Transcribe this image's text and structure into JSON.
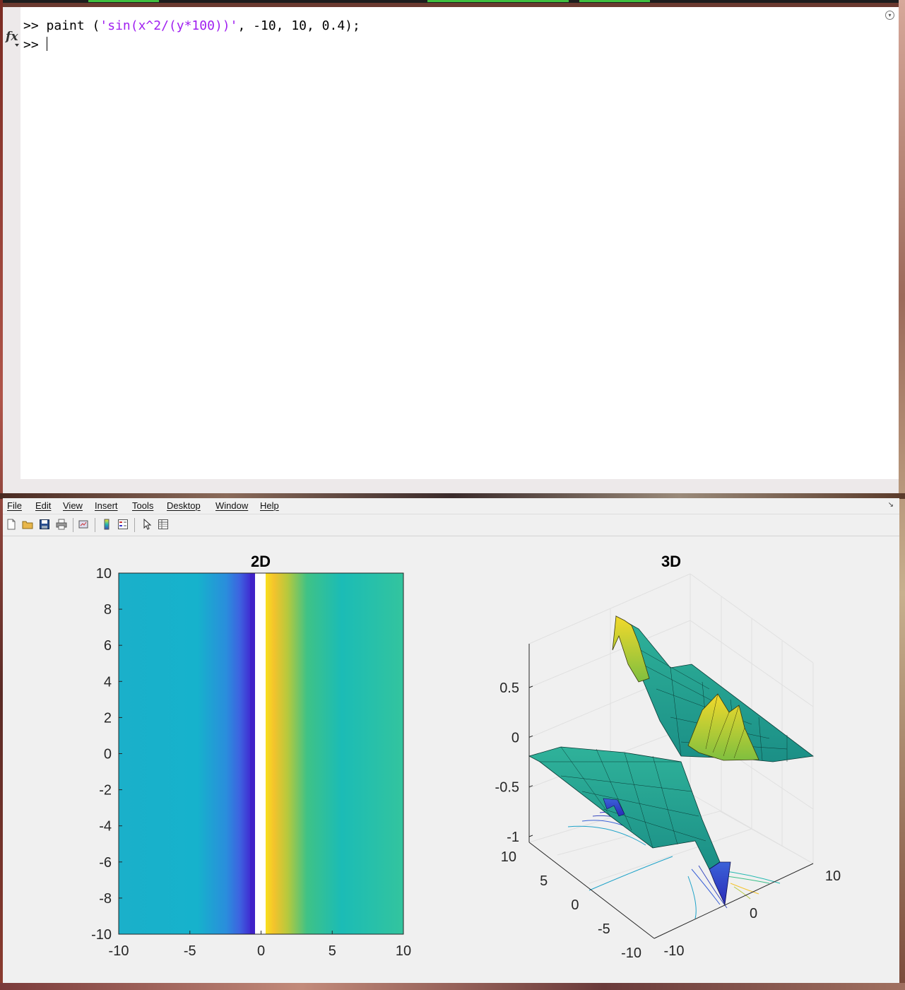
{
  "command_window": {
    "prompt": ">>",
    "history_line": {
      "prefix": "paint (",
      "string_arg": "'sin(x^2/(y*100))'",
      "suffix": ", -10, 10, 0.4);"
    },
    "fx_label": "fx"
  },
  "figure": {
    "menu": [
      "File",
      "Edit",
      "View",
      "Insert",
      "Tools",
      "Desktop",
      "Window",
      "Help"
    ],
    "toolbar_icons": [
      "new-figure-icon",
      "open-file-icon",
      "save-icon",
      "print-icon",
      "link-plot-icon",
      "colorbar-icon",
      "legend-icon",
      "select-pointer-icon",
      "property-inspector-icon"
    ]
  },
  "colors": {
    "string_literal": "#a020f0",
    "colormap": [
      "#440154",
      "#3b4cc0",
      "#1fa3c9",
      "#23b9b0",
      "#3cc08a",
      "#f9e721"
    ]
  },
  "chart_data": [
    {
      "type": "heatmap",
      "title": "2D",
      "xlabel": "",
      "ylabel": "",
      "x_ticks": [
        -10,
        -5,
        0,
        5,
        10
      ],
      "y_ticks": [
        -10,
        -8,
        -6,
        -4,
        -2,
        0,
        2,
        4,
        6,
        8,
        10
      ],
      "xlim": [
        -10,
        10
      ],
      "ylim": [
        -10,
        10
      ],
      "function": "sin(x^2/(y*100))",
      "step": 0.4,
      "note_band": "blank column near x = 0"
    },
    {
      "type": "surface",
      "title": "3D",
      "x_ticks": [
        -10,
        0,
        10
      ],
      "y_ticks": [
        -10,
        -5,
        0,
        5,
        10
      ],
      "z_ticks": [
        -1,
        -0.5,
        0,
        0.5
      ],
      "xlim": [
        -10,
        10
      ],
      "ylim": [
        -10,
        10
      ],
      "zlim": [
        -1,
        1
      ],
      "grid": true,
      "contour_below": true
    }
  ]
}
